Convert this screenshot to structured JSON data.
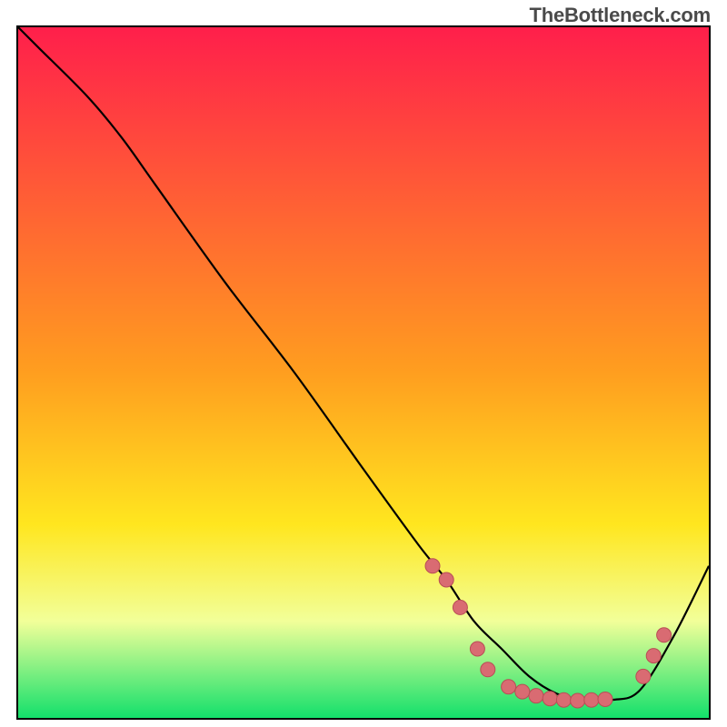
{
  "watermark": {
    "text": "TheBottleneck.com"
  },
  "colors": {
    "gradient_top": "#ff1f4b",
    "gradient_mid1": "#ff9e1f",
    "gradient_mid2": "#ffe61f",
    "gradient_mid3": "#f2ff99",
    "gradient_bottom": "#13e06b",
    "curve": "#000000",
    "dot_fill": "#d96b72",
    "dot_stroke": "#b84e55"
  },
  "chart_data": {
    "type": "line",
    "title": "",
    "xlabel": "",
    "ylabel": "",
    "xlim": [
      0,
      100
    ],
    "ylim": [
      0,
      100
    ],
    "background_gradient": {
      "direction": "vertical",
      "stops": [
        {
          "pos": 0.0,
          "color": "#ff1f4b"
        },
        {
          "pos": 0.5,
          "color": "#ff9e1f"
        },
        {
          "pos": 0.72,
          "color": "#ffe61f"
        },
        {
          "pos": 0.86,
          "color": "#f2ff99"
        },
        {
          "pos": 1.0,
          "color": "#13e06b"
        }
      ]
    },
    "series": [
      {
        "name": "curve",
        "x": [
          0,
          3,
          10,
          15,
          20,
          30,
          40,
          50,
          58,
          62,
          66,
          70,
          74,
          78,
          82,
          86,
          90,
          95,
          100
        ],
        "y": [
          100,
          97,
          90,
          84,
          77,
          63,
          50,
          36,
          25,
          20,
          14,
          10,
          6,
          3.5,
          2.6,
          2.6,
          4,
          12,
          22
        ]
      }
    ],
    "highlight_points": [
      {
        "x": 60,
        "y": 22
      },
      {
        "x": 62,
        "y": 20
      },
      {
        "x": 64,
        "y": 16
      },
      {
        "x": 66.5,
        "y": 10
      },
      {
        "x": 68,
        "y": 7
      },
      {
        "x": 71,
        "y": 4.5
      },
      {
        "x": 73,
        "y": 3.8
      },
      {
        "x": 75,
        "y": 3.2
      },
      {
        "x": 77,
        "y": 2.8
      },
      {
        "x": 79,
        "y": 2.6
      },
      {
        "x": 81,
        "y": 2.5
      },
      {
        "x": 83,
        "y": 2.6
      },
      {
        "x": 85,
        "y": 2.7
      },
      {
        "x": 90.5,
        "y": 6
      },
      {
        "x": 92,
        "y": 9
      },
      {
        "x": 93.5,
        "y": 12
      }
    ]
  }
}
